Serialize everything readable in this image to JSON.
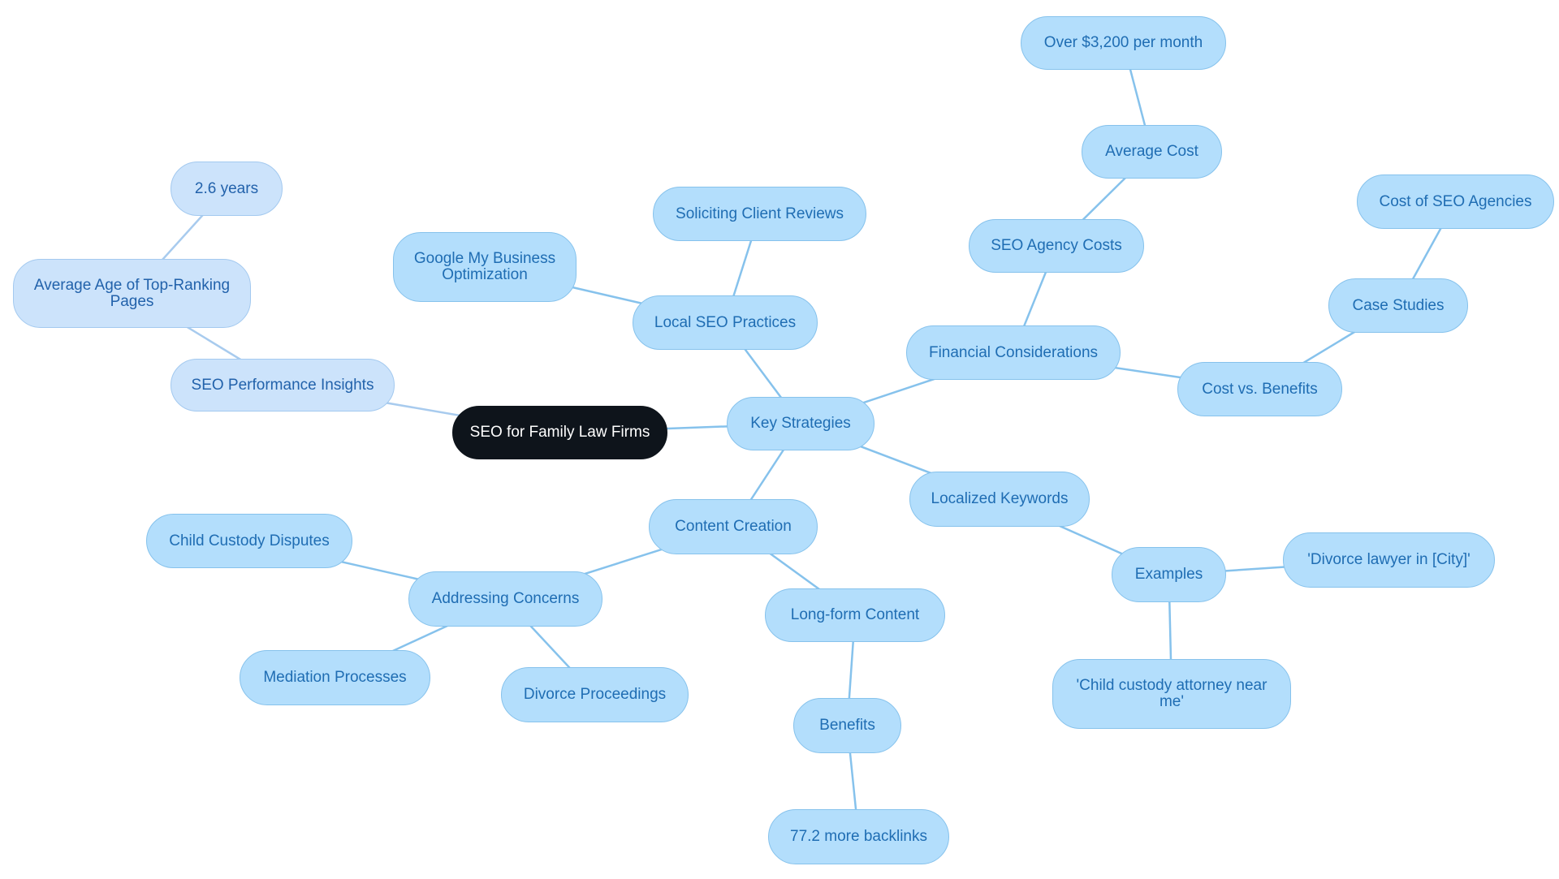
{
  "mindmap": {
    "colors": {
      "root_fill": "#0e141b",
      "root_text": "#ffffff",
      "node_fill": "#b3defc",
      "node_border": "#86c2ec",
      "node_text": "#1f6db3",
      "light_fill": "#cce3fb",
      "light_border": "#a3c9ef",
      "light_text": "#2262ab",
      "edge": "#86c2ec",
      "light_edge": "#a8cbee"
    },
    "nodes": {
      "root": "SEO for Family Law Firms",
      "perf_insights": "SEO Performance Insights",
      "avg_age": "Average Age of Top-Ranking Pages",
      "years": "2.6 years",
      "key_strategies": "Key Strategies",
      "local_seo": "Local SEO Practices",
      "gmb": "Google My Business Optimization",
      "reviews": "Soliciting Client Reviews",
      "financial": "Financial Considerations",
      "agency_costs": "SEO Agency Costs",
      "average_cost": "Average Cost",
      "over_3200": "Over $3,200 per month",
      "cost_benefits": "Cost vs. Benefits",
      "case_studies": "Case Studies",
      "cost_agencies": "Cost of SEO Agencies",
      "localized_keywords": "Localized Keywords",
      "examples": "Examples",
      "divorce_lawyer": "'Divorce lawyer in [City]'",
      "child_custody_attorney": "'Child custody attorney near me'",
      "content_creation": "Content Creation",
      "addressing_concerns": "Addressing Concerns",
      "child_custody_disputes": "Child Custody Disputes",
      "mediation": "Mediation Processes",
      "divorce_proceedings": "Divorce Proceedings",
      "long_form": "Long-form Content",
      "benefits": "Benefits",
      "backlinks": "77.2 more backlinks"
    },
    "edges": [
      [
        "root",
        "perf_insights"
      ],
      [
        "perf_insights",
        "avg_age"
      ],
      [
        "avg_age",
        "years"
      ],
      [
        "root",
        "key_strategies"
      ],
      [
        "key_strategies",
        "local_seo"
      ],
      [
        "local_seo",
        "gmb"
      ],
      [
        "local_seo",
        "reviews"
      ],
      [
        "key_strategies",
        "financial"
      ],
      [
        "financial",
        "agency_costs"
      ],
      [
        "agency_costs",
        "average_cost"
      ],
      [
        "average_cost",
        "over_3200"
      ],
      [
        "financial",
        "cost_benefits"
      ],
      [
        "cost_benefits",
        "case_studies"
      ],
      [
        "case_studies",
        "cost_agencies"
      ],
      [
        "key_strategies",
        "localized_keywords"
      ],
      [
        "localized_keywords",
        "examples"
      ],
      [
        "examples",
        "divorce_lawyer"
      ],
      [
        "examples",
        "child_custody_attorney"
      ],
      [
        "key_strategies",
        "content_creation"
      ],
      [
        "content_creation",
        "addressing_concerns"
      ],
      [
        "addressing_concerns",
        "child_custody_disputes"
      ],
      [
        "addressing_concerns",
        "mediation"
      ],
      [
        "addressing_concerns",
        "divorce_proceedings"
      ],
      [
        "content_creation",
        "long_form"
      ],
      [
        "long_form",
        "benefits"
      ],
      [
        "benefits",
        "backlinks"
      ]
    ]
  }
}
